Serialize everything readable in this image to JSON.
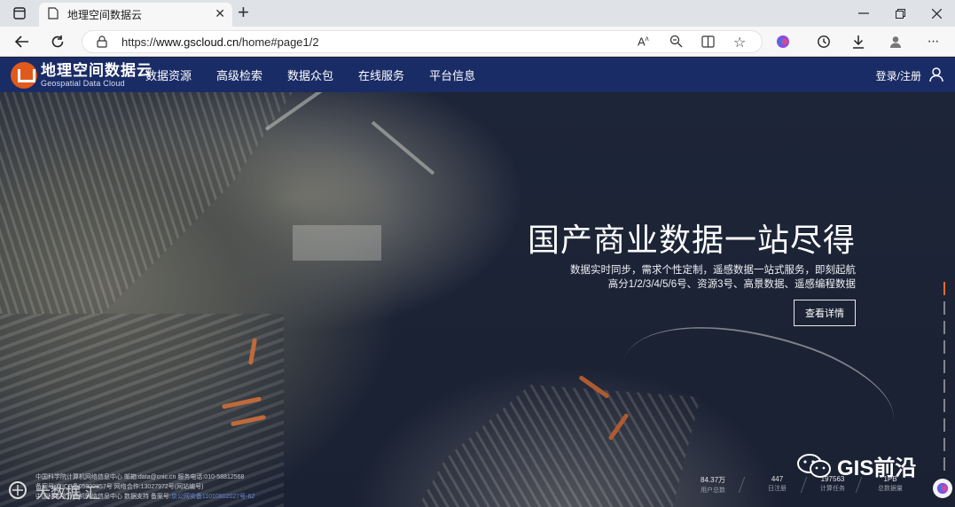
{
  "browser": {
    "tab_title": "地理空间数据云",
    "url_prefix": "https://",
    "url_host": "www.gscloud.cn",
    "url_path": "/home#page1/2"
  },
  "site": {
    "logo_cn": "地理空间数据云",
    "logo_en": "Geospatial Data Cloud",
    "nav": [
      "数据资源",
      "高级检索",
      "数据众包",
      "在线服务",
      "平台信息"
    ],
    "login": "登录/注册"
  },
  "hero": {
    "title": "国产商业数据一站尽得",
    "subtitle_line1": "数据实时同步，需求个性定制，遥感数据一站式服务，即刻起航",
    "subtitle_line2": "高分1/2/3/4/5/6号、资源3号、高景数据、遥感编程数据",
    "detail_button": "查看详情"
  },
  "footer": {
    "line1": "中国科学院计算机网络信息中心 邮箱:data@cnic.cn 服务电话:010-58812568",
    "line2": "备案号:京ICP备05002857号  网络合作:13027972号(网站编号)",
    "line3": "中国科学院计算机网络信息中心 数据支持 备案号:",
    "line3_link": "京公网安备11010802027号-62"
  },
  "stats": [
    {
      "value": "84.37万",
      "label": "用户总数"
    },
    {
      "value": "447",
      "label": "日注册"
    },
    {
      "value": "197563",
      "label": "计算任务"
    },
    {
      "value": "1PB",
      "label": "总数据量"
    }
  ],
  "watermarks": {
    "right": "GIS前沿",
    "left": "大数据 汇"
  },
  "colors": {
    "header_bg": "#1a2c66",
    "pager_active": "#f06a2a",
    "logo_accent": "#e05a1c"
  }
}
